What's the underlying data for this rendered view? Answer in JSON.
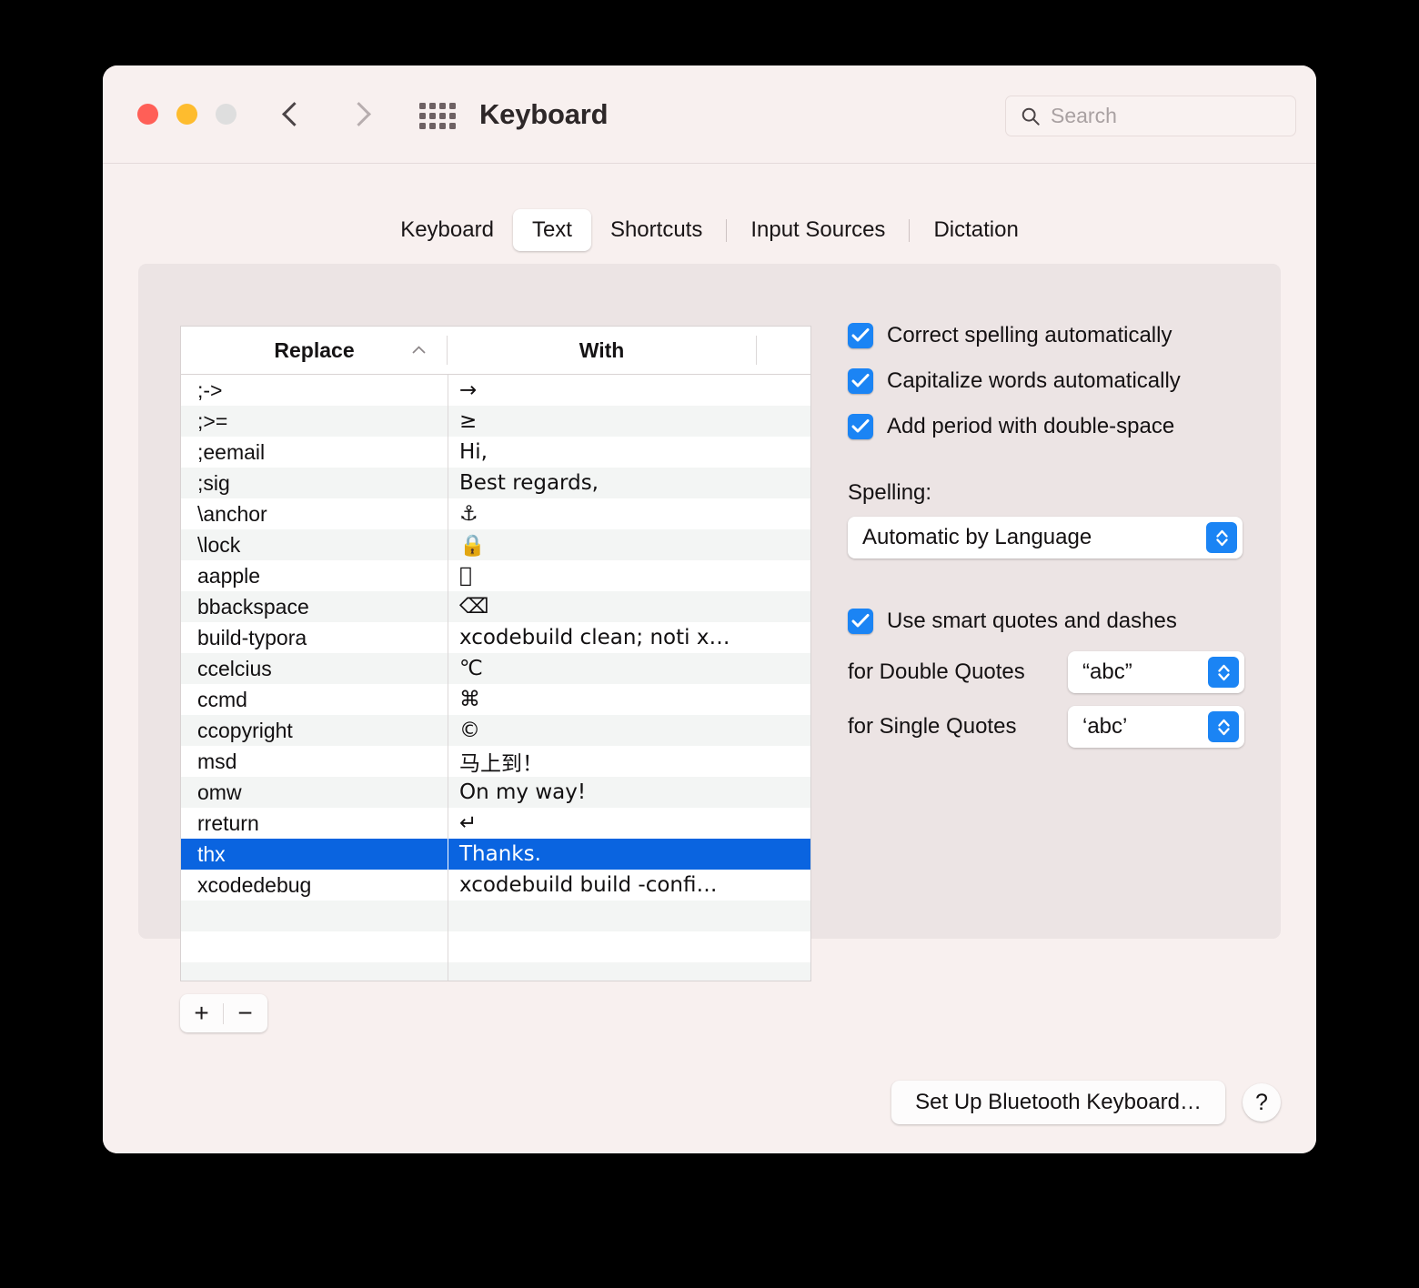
{
  "window": {
    "title": "Keyboard",
    "traffic_lights": [
      "close",
      "minimize",
      "zoom"
    ],
    "nav": {
      "back": "back-chevron",
      "forward": "forward-chevron"
    },
    "grid_icon": "show-all-icon",
    "search": {
      "placeholder": "Search",
      "value": "",
      "icon": "search-icon"
    }
  },
  "tabs": [
    {
      "label": "Keyboard",
      "active": false
    },
    {
      "label": "Text",
      "active": true
    },
    {
      "label": "Shortcuts",
      "active": false
    },
    {
      "label": "Input Sources",
      "active": false
    },
    {
      "label": "Dictation",
      "active": false
    }
  ],
  "table": {
    "columns": {
      "replace": "Replace",
      "with": "With"
    },
    "sort": {
      "column": "Replace",
      "direction": "ascending",
      "icon": "chevron-up-icon"
    },
    "rows": [
      {
        "replace": ";->",
        "with": "→"
      },
      {
        "replace": ";>=",
        "with": "≥"
      },
      {
        "replace": ";eemail",
        "with": "Hi,"
      },
      {
        "replace": ";sig",
        "with": "Best regards,"
      },
      {
        "replace": "\\anchor",
        "with": "⚓"
      },
      {
        "replace": "\\lock",
        "with": "🔒"
      },
      {
        "replace": "aapple",
        "with": ""
      },
      {
        "replace": "bbackspace",
        "with": "⌫"
      },
      {
        "replace": "build-typora",
        "with": "xcodebuild clean; noti x…"
      },
      {
        "replace": "ccelcius",
        "with": "℃"
      },
      {
        "replace": "ccmd",
        "with": "⌘"
      },
      {
        "replace": "ccopyright",
        "with": "©"
      },
      {
        "replace": "msd",
        "with": "马上到！"
      },
      {
        "replace": "omw",
        "with": "On my way!"
      },
      {
        "replace": "rreturn",
        "with": "↵"
      },
      {
        "replace": "thx",
        "with": "Thanks."
      },
      {
        "replace": "xcodedebug",
        "with": "xcodebuild build -confi…"
      }
    ],
    "selected_index": 15,
    "empty_rows": 4,
    "add_button": "+",
    "remove_button": "−"
  },
  "options": {
    "checkboxes": [
      {
        "label": "Correct spelling automatically",
        "checked": true
      },
      {
        "label": "Capitalize words automatically",
        "checked": true
      },
      {
        "label": "Add period with double-space",
        "checked": true
      }
    ],
    "spelling": {
      "label": "Spelling:",
      "value": "Automatic by Language"
    },
    "smart_quotes": {
      "checkbox_label": "Use smart quotes and dashes",
      "checked": true,
      "double_label": "for Double Quotes",
      "double_value": "“abc”",
      "single_label": "for Single Quotes",
      "single_value": "‘abc’"
    }
  },
  "footer": {
    "bluetooth_button": "Set Up Bluetooth Keyboard…",
    "help_button": "?"
  },
  "colors": {
    "window_bg": "#f8f0ef",
    "panel_bg": "#ece4e4",
    "selection_blue": "#0a64e0",
    "control_blue": "#1b84f4",
    "traffic_red": "#ff5f57",
    "traffic_yellow": "#febc2e",
    "traffic_gray": "#dedede"
  }
}
